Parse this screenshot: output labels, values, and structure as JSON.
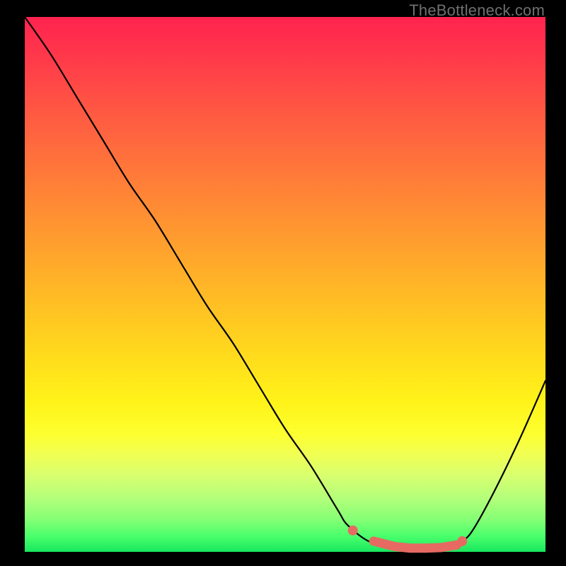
{
  "watermark": "TheBottleneck.com",
  "colors": {
    "background": "#000000",
    "curve": "#000000",
    "marker": "#e66a62"
  },
  "chart_data": {
    "type": "line",
    "title": "",
    "xlabel": "",
    "ylabel": "",
    "xlim": [
      0,
      100
    ],
    "ylim": [
      0,
      100
    ],
    "grid": false,
    "legend": false,
    "background": "rainbow-gradient-vertical-red-to-green",
    "description": "Bottleneck curve: high on left, drops steeply to a flat minimum around x≈72-83, then rises on the right.",
    "x": [
      0,
      5,
      10,
      15,
      20,
      25,
      30,
      35,
      40,
      45,
      50,
      55,
      60,
      62,
      66,
      70,
      74,
      78,
      82,
      84,
      86,
      90,
      95,
      100
    ],
    "y": [
      100,
      93,
      85,
      77,
      69,
      62,
      54,
      46,
      39,
      31,
      23,
      16,
      8,
      5,
      2,
      1,
      0.5,
      0.5,
      1,
      2,
      4,
      11,
      21,
      32
    ],
    "markers": {
      "comment": "salmon dots/segments highlighting the flat minimum region",
      "x": [
        63,
        67,
        71,
        74,
        77,
        80,
        83,
        84
      ],
      "y": [
        4,
        2,
        1,
        0.7,
        0.7,
        0.8,
        1.3,
        2
      ]
    }
  }
}
